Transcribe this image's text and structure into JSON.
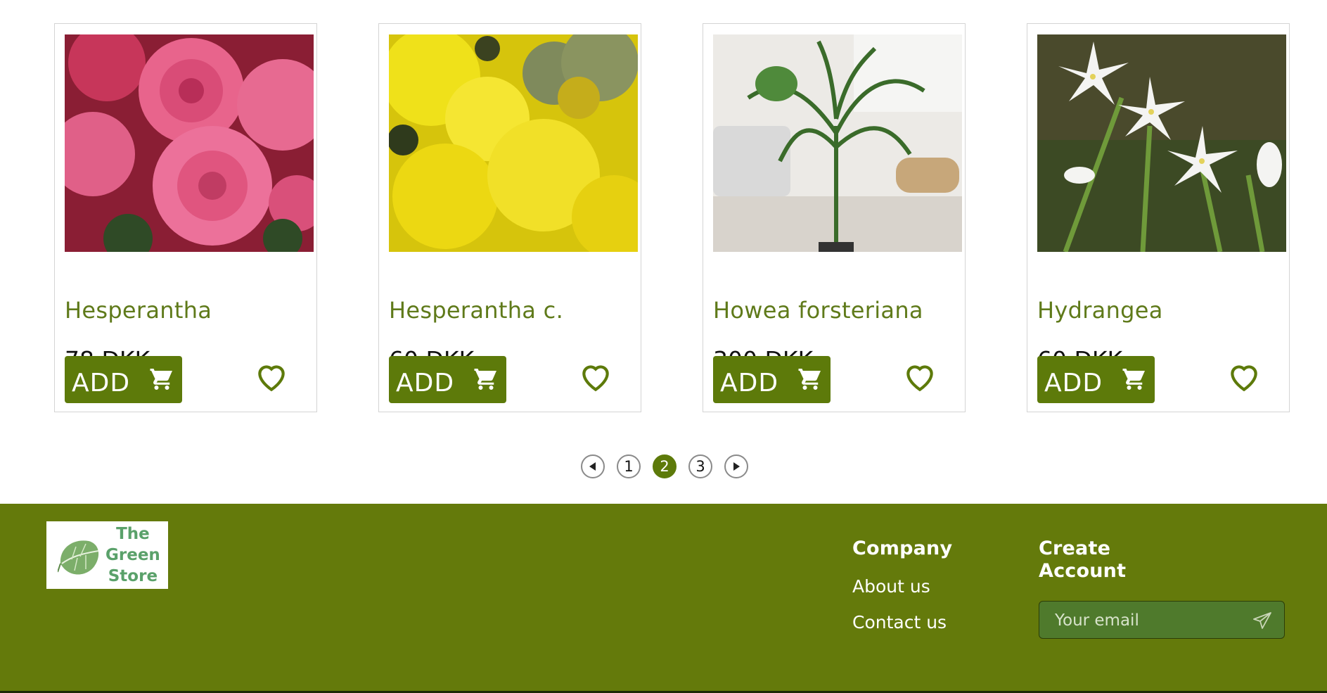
{
  "products": [
    {
      "name": "Hesperantha",
      "price": "78 DKK",
      "image": "pink-roses-photo"
    },
    {
      "name": "Hesperantha c.",
      "price": "60 DKK",
      "image": "yellow-yarrow-photo"
    },
    {
      "name": "Howea forsteriana",
      "price": "300 DKK",
      "image": "kentia-palm-photo"
    },
    {
      "name": "Hydrangea",
      "price": "60 DKK",
      "image": "white-star-flowers-photo"
    }
  ],
  "buttons": {
    "add_label": "ADD",
    "cart_icon": "cart-icon",
    "favorite_icon": "heart-icon"
  },
  "pagination": {
    "pages": [
      "1",
      "2",
      "3"
    ],
    "current_page": 2,
    "prev_icon": "prev-arrow-icon",
    "next_icon": "next-arrow-icon"
  },
  "footer": {
    "logo_lines": [
      "The",
      "Green",
      "Store"
    ],
    "company": {
      "title": "Company",
      "links": [
        "About us",
        "Contact us"
      ]
    },
    "account": {
      "title_lines": [
        "Create",
        "Account"
      ],
      "email_placeholder": "Your email",
      "send_icon": "send-icon"
    }
  },
  "colors": {
    "brand_green": "#5d7a0a",
    "footer_green": "#647a0b",
    "product_name": "#5f7a1a"
  }
}
